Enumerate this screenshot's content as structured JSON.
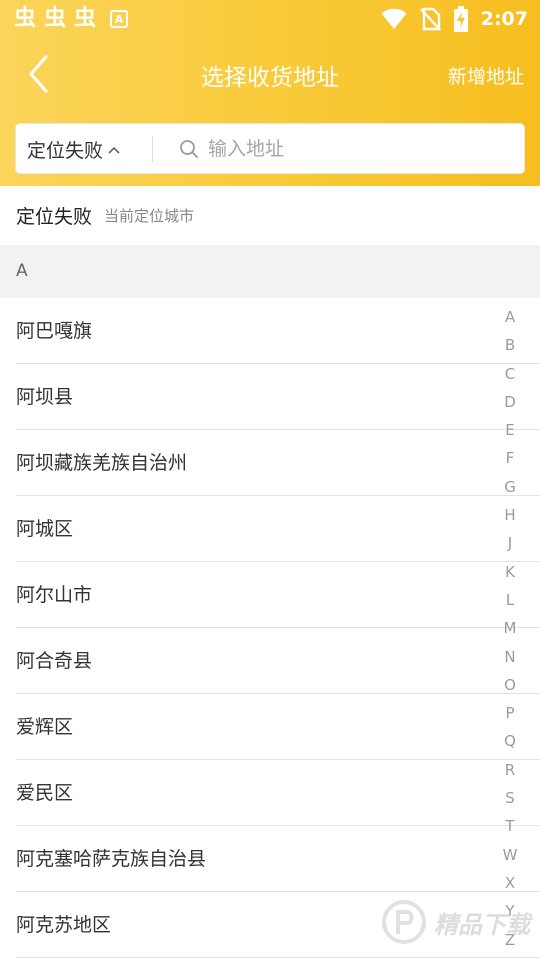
{
  "status_bar": {
    "notif_icons": [
      "虫",
      "虫",
      "虫"
    ],
    "badge_letter": "A",
    "time": "2:07"
  },
  "title_bar": {
    "title": "选择收货地址",
    "action": "新增地址"
  },
  "search": {
    "location_label": "定位失败",
    "placeholder": "输入地址",
    "value": ""
  },
  "current_location": {
    "label": "定位失败",
    "hint": "当前定位城市"
  },
  "section_header": "A",
  "cities": [
    "阿巴嘎旗",
    "阿坝县",
    "阿坝藏族羌族自治州",
    "阿城区",
    "阿尔山市",
    "阿合奇县",
    "爱辉区",
    "爱民区",
    "阿克塞哈萨克族自治县",
    "阿克苏地区"
  ],
  "alphabet_index": [
    "A",
    "B",
    "C",
    "D",
    "E",
    "F",
    "G",
    "H",
    "J",
    "K",
    "L",
    "M",
    "N",
    "O",
    "P",
    "Q",
    "R",
    "S",
    "T",
    "W",
    "X",
    "Y",
    "Z"
  ],
  "watermark": {
    "text": "精品下载"
  },
  "colors": {
    "header_start": "#fbd45a",
    "header_end": "#f6be1f",
    "section_bg": "#f2f2f2"
  }
}
